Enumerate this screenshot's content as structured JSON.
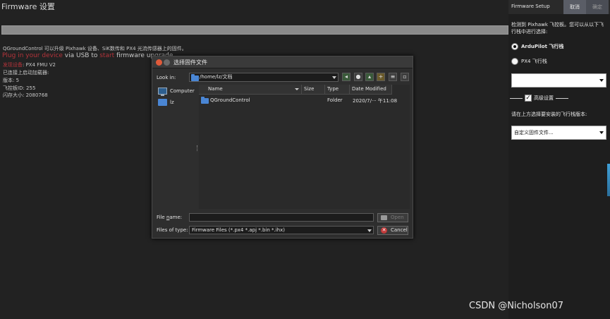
{
  "main": {
    "title": "Firmware 设置",
    "progress": 1.0,
    "intro": "QGroundControl 可以升级 Pixhawk 设备、SiK数传和 PX4 光流传感器上的固件。",
    "plug_part1": "Plug in your device",
    "plug_part2": " via USB to ",
    "plug_part3": "start",
    "plug_part4": " firmware upgrade.",
    "found_prefix": "发现设备",
    "found_value": ": PX4 FMU V2",
    "connected_bootloader": "已连接上启动加载器:",
    "version": "版本:  5",
    "board_id": "飞控板ID:  255",
    "flash_size": "闪存大小:  2080768"
  },
  "right_panel": {
    "title": "Firmware Setup",
    "cancel_label": "取消",
    "ok_label": "确定",
    "detect_text": "检测到 Pixhawk 飞控板。您可以从以下飞行栈中进行选择:",
    "option_ardupilot": "ArduPilot 飞行栈",
    "option_px4": "PX4 飞行栈",
    "vehicle_select_value": "",
    "advanced_label": "高级设置",
    "version_prompt": "请在上方选择要安装的飞行栈版本:",
    "firmware_select_value": "自定义固件文件..."
  },
  "dialog": {
    "title": "选择固件文件",
    "look_in_label": "Look in:",
    "look_in_value": "/home/lz/文档",
    "places": [
      {
        "label": "Computer"
      },
      {
        "label": "lz"
      }
    ],
    "columns": {
      "name": "Name",
      "size": "Size",
      "type": "Type",
      "date": "Date Modified"
    },
    "files": [
      {
        "name": "QGroundControl",
        "size": "",
        "type": "Folder",
        "date": "2020/7/··· 午11:08"
      }
    ],
    "file_name_label": "File name:",
    "file_name_underline": "n",
    "file_name_value": "",
    "files_of_type_label": "Files of type:",
    "files_of_type_value": "Firmware Files (*.px4 *.apj *.bin *.ihx)",
    "open_label": "Open",
    "cancel_label": "Cancel"
  },
  "watermark": "CSDN @Nicholson07",
  "colors": {
    "background": "#222222",
    "red_text": "#b3333a",
    "folder_blue": "#4a86d4",
    "close_button": "#e05a3a"
  }
}
